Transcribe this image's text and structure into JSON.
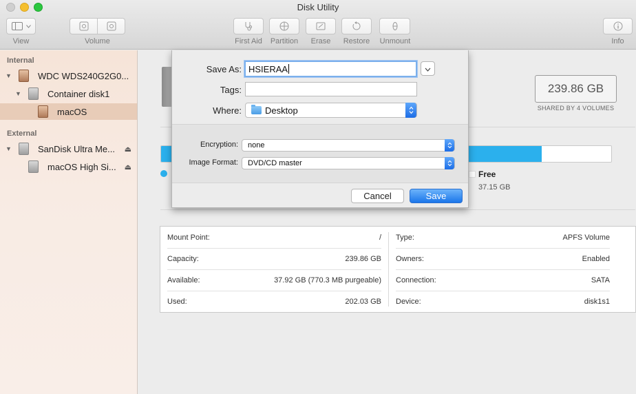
{
  "window": {
    "title": "Disk Utility"
  },
  "toolbar": {
    "view_label": "View",
    "volume_label": "Volume",
    "first_aid_label": "First Aid",
    "partition_label": "Partition",
    "erase_label": "Erase",
    "restore_label": "Restore",
    "unmount_label": "Unmount",
    "info_label": "Info"
  },
  "sidebar": {
    "internal_header": "Internal",
    "external_header": "External",
    "internal_items": [
      {
        "label": "WDC WDS240G2G0..."
      },
      {
        "label": "Container disk1"
      },
      {
        "label": "macOS"
      }
    ],
    "external_items": [
      {
        "label": "SanDisk Ultra Me..."
      },
      {
        "label": "macOS High Si..."
      }
    ]
  },
  "main": {
    "capacity": "239.86 GB",
    "shared_label": "SHARED BY 4 VOLUMES",
    "usage_fraction": 0.845,
    "free_label": "Free",
    "free_size": "37.15 GB",
    "info_left": [
      {
        "key": "Mount Point:",
        "value": "/"
      },
      {
        "key": "Capacity:",
        "value": "239.86 GB"
      },
      {
        "key": "Available:",
        "value": "37.92 GB (770.3 MB purgeable)"
      },
      {
        "key": "Used:",
        "value": "202.03 GB"
      }
    ],
    "info_right": [
      {
        "key": "Type:",
        "value": "APFS Volume"
      },
      {
        "key": "Owners:",
        "value": "Enabled"
      },
      {
        "key": "Connection:",
        "value": "SATA"
      },
      {
        "key": "Device:",
        "value": "disk1s1"
      }
    ]
  },
  "dialog": {
    "save_as_label": "Save As:",
    "save_as_value": "HSIERAA",
    "tags_label": "Tags:",
    "tags_value": "",
    "where_label": "Where:",
    "where_value": "Desktop",
    "encryption_label": "Encryption:",
    "encryption_value": "none",
    "format_label": "Image Format:",
    "format_value": "DVD/CD master",
    "cancel_label": "Cancel",
    "save_label": "Save"
  },
  "colors": {
    "accent": "#2bb0ed",
    "save_button": "#1b76ea",
    "sidebar_selected": "#e8ccb8"
  }
}
